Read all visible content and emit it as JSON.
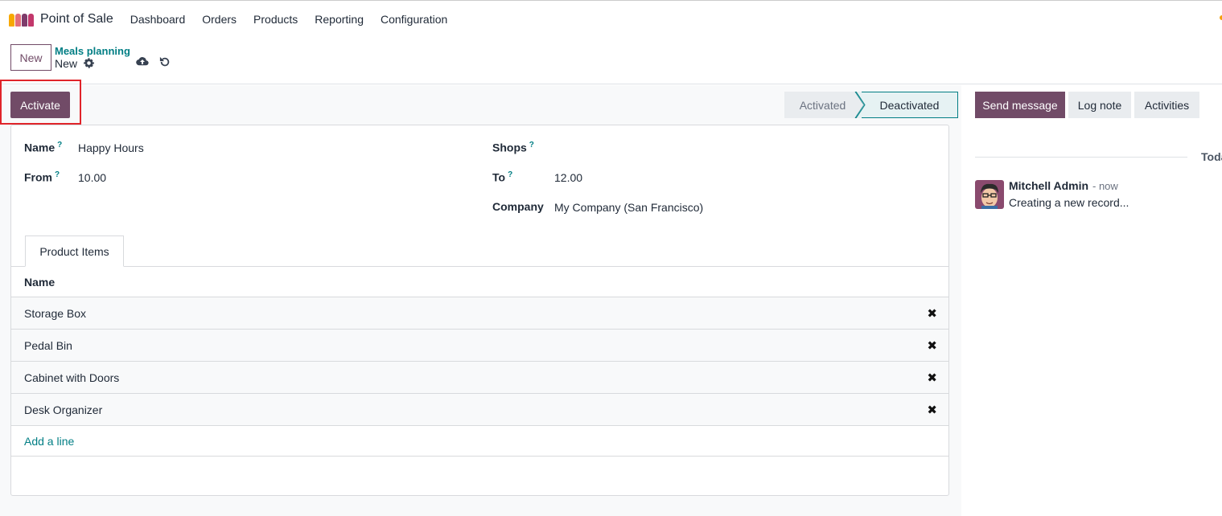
{
  "navbar": {
    "app_title": "Point of Sale",
    "menu": [
      "Dashboard",
      "Orders",
      "Products",
      "Reporting",
      "Configuration"
    ],
    "logo_colors": [
      "#f7a800",
      "#e46e78",
      "#7e3b6a",
      "#c2376b"
    ]
  },
  "control_panel": {
    "new_label": "New",
    "breadcrumb_parent": "Meals planning",
    "breadcrumb_current": "New"
  },
  "actions": {
    "activate_label": "Activate"
  },
  "statusbar": {
    "stages": [
      "Activated",
      "Deactivated"
    ],
    "current": "Deactivated"
  },
  "form": {
    "name_label": "Name",
    "name_value": "Happy Hours",
    "from_label": "From",
    "from_value": "10.00",
    "shops_label": "Shops",
    "shops_value": "",
    "to_label": "To",
    "to_value": "12.00",
    "company_label": "Company",
    "company_value": "My Company (San Francisco)",
    "help_mark": "?"
  },
  "tabs": {
    "product_items": "Product Items"
  },
  "product_table": {
    "header": "Name",
    "rows": [
      "Storage Box",
      "Pedal Bin",
      "Cabinet with Doors",
      "Desk Organizer"
    ],
    "delete_glyph": "✖",
    "add_line": "Add a line"
  },
  "chatter": {
    "send_message": "Send message",
    "log_note": "Log note",
    "activities": "Activities",
    "date_separator": "Toda",
    "author": "Mitchell Admin",
    "time": "- now",
    "body": "Creating a new record..."
  },
  "colors": {
    "primary": "#714b67",
    "link": "#017e84",
    "highlight": "#e0242a"
  }
}
